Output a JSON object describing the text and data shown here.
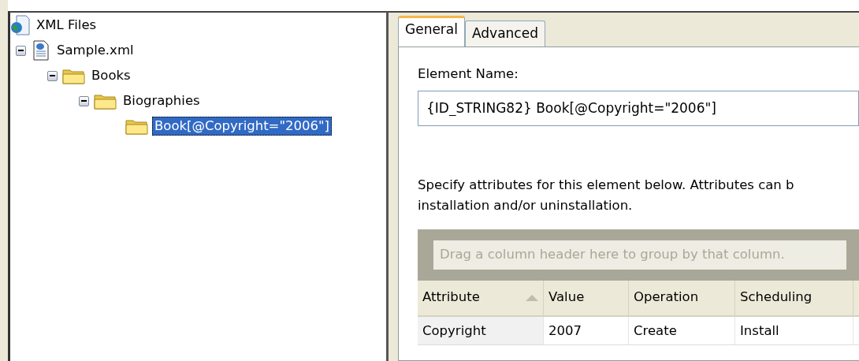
{
  "tree": [
    {
      "label": "XML Files",
      "kind": "root",
      "selected": false,
      "children": [
        {
          "label": "Sample.xml",
          "kind": "xml",
          "expanded": true,
          "selected": false,
          "children": [
            {
              "label": "Books",
              "kind": "folder",
              "expanded": true,
              "selected": false,
              "children": [
                {
                  "label": "Biographies",
                  "kind": "folder",
                  "expanded": true,
                  "selected": false,
                  "children": [
                    {
                      "label": "Book[@Copyright=\"2006\"]",
                      "kind": "folder",
                      "selected": true
                    }
                  ]
                }
              ]
            }
          ]
        }
      ]
    }
  ],
  "tabs": [
    {
      "label": "General",
      "selected": true
    },
    {
      "label": "Advanced",
      "selected": false
    }
  ],
  "element_name": {
    "label": "Element Name:",
    "value": "{ID_STRING82} Book[@Copyright=\"2006\"]"
  },
  "description": [
    "Specify attributes for this element below. Attributes can b",
    "installation and/or uninstallation."
  ],
  "grid": {
    "group_hint": "Drag a column header here to group by that column.",
    "columns": [
      {
        "label": "Attribute",
        "sort_ascending": true
      },
      {
        "label": "Value"
      },
      {
        "label": "Operation"
      },
      {
        "label": "Scheduling"
      }
    ],
    "rows": [
      [
        "Copyright",
        "2007",
        "Create",
        "Install"
      ]
    ]
  }
}
